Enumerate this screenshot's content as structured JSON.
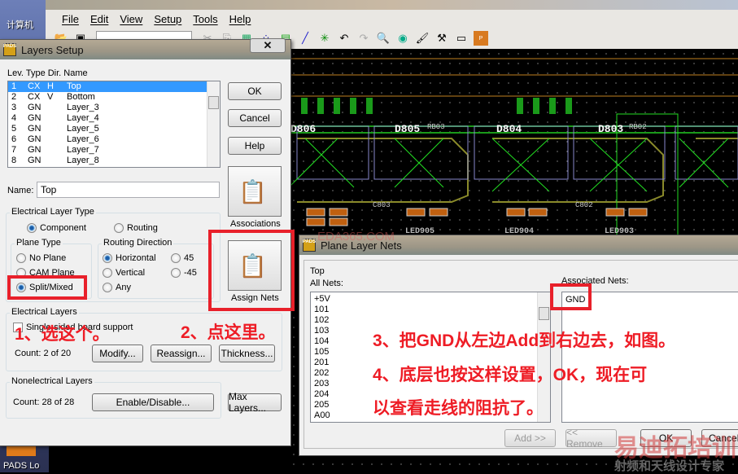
{
  "desktop": {
    "icons": [
      {
        "label": "计算机"
      },
      {
        "label": "PADS Lo"
      }
    ]
  },
  "menu": [
    "File",
    "Edit",
    "View",
    "Setup",
    "Tools",
    "Help"
  ],
  "pcb": {
    "refs": [
      "D806",
      "D805",
      "D804",
      "D803",
      "RB03",
      "RB02",
      "C803",
      "C802",
      "LED905",
      "LED904",
      "LED903"
    ]
  },
  "layers_setup": {
    "title": "Layers Setup",
    "columns_header": "Lev. Type Dir. Name",
    "layers": [
      {
        "lev": "1",
        "type": "CX",
        "dir": "H",
        "name": "Top"
      },
      {
        "lev": "2",
        "type": "CX",
        "dir": "V",
        "name": "Bottom"
      },
      {
        "lev": "3",
        "type": "GN",
        "dir": "",
        "name": "Layer_3"
      },
      {
        "lev": "4",
        "type": "GN",
        "dir": "",
        "name": "Layer_4"
      },
      {
        "lev": "5",
        "type": "GN",
        "dir": "",
        "name": "Layer_5"
      },
      {
        "lev": "6",
        "type": "GN",
        "dir": "",
        "name": "Layer_6"
      },
      {
        "lev": "7",
        "type": "GN",
        "dir": "",
        "name": "Layer_7"
      },
      {
        "lev": "8",
        "type": "GN",
        "dir": "",
        "name": "Layer_8"
      }
    ],
    "ok": "OK",
    "cancel": "Cancel",
    "help": "Help",
    "associations": "Associations",
    "assign_nets": "Assign Nets",
    "name_label": "Name:",
    "name_value": "Top",
    "elec_layer_type": "Electrical Layer Type",
    "component": "Component",
    "routing": "Routing",
    "plane_type": "Plane Type",
    "no_plane": "No Plane",
    "cam_plane": "CAM Plane",
    "split_mixed": "Split/Mixed",
    "routing_direction": "Routing Direction",
    "horizontal": "Horizontal",
    "vertical": "Vertical",
    "any": "Any",
    "d45": "45",
    "dm45": "-45",
    "electrical_layers": "Electrical Layers",
    "single_support": "Single-sided board support",
    "count_elec": "Count:  2 of 20",
    "modify": "Modify...",
    "reassign": "Reassign...",
    "thickness": "Thickness...",
    "nonelectrical_layers": "Nonelectrical Layers",
    "count_nonelec": "Count: 28 of 28",
    "enable_disable": "Enable/Disable...",
    "max_layers": "Max Layers..."
  },
  "plane_nets": {
    "title": "Plane Layer Nets",
    "layer": "Top",
    "all_nets_label": "All Nets:",
    "all_nets": [
      "+5V",
      "101",
      "102",
      "103",
      "104",
      "105",
      "201",
      "202",
      "203",
      "204",
      "205",
      "A00"
    ],
    "associated_label": "Associated Nets:",
    "associated": [
      "GND"
    ],
    "add": "Add >>",
    "remove": "<< Remove",
    "ok": "OK",
    "cancel": "Cancel"
  },
  "annotations": {
    "step1": "1、选这个。",
    "step2": "2、点这里。",
    "step3": "3、把GND从左边Add到右边去，如图。",
    "step4a": "4、底层也按这样设置，OK，现在可",
    "step4b": "以查看走线的阻抗了。",
    "annotation_color": "#ee1c25"
  },
  "watermarks": {
    "site": "EDA365.COM",
    "brand": "易迪拓培训",
    "slogan": "射频和天线设计专家"
  }
}
